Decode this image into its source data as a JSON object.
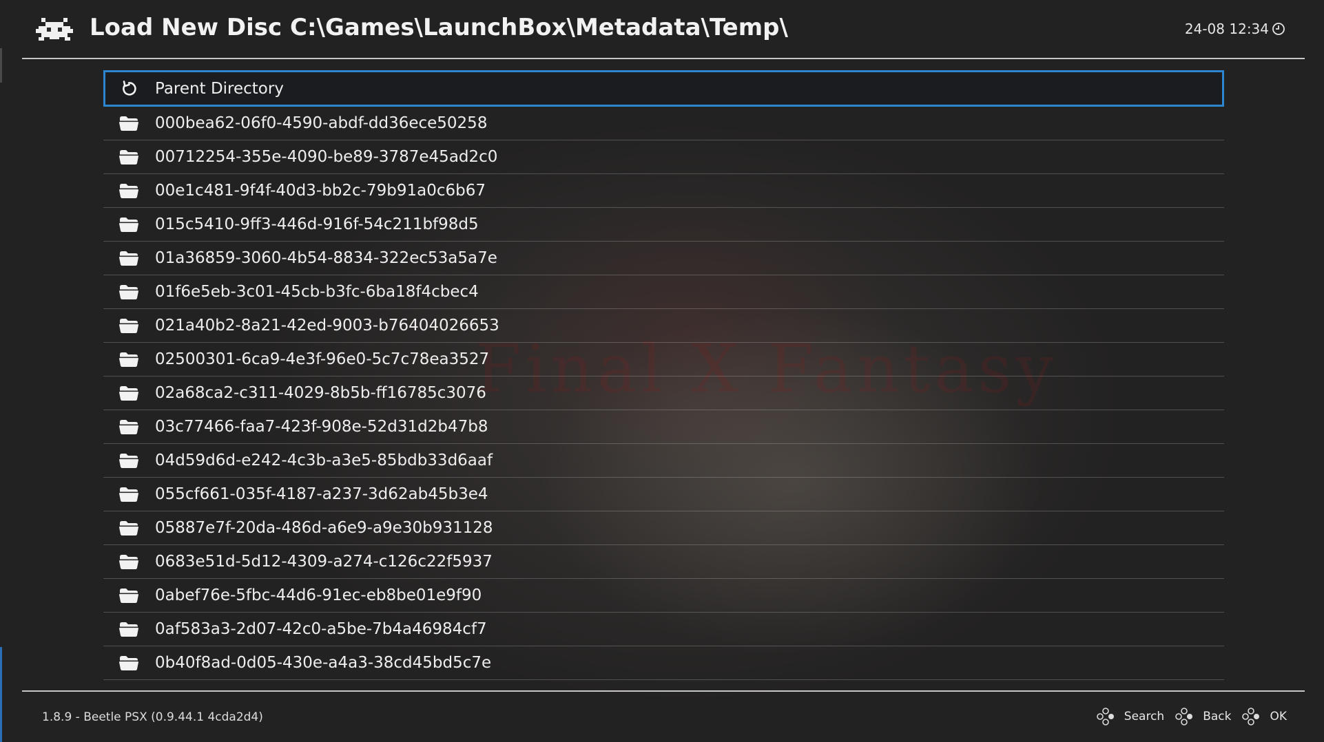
{
  "header": {
    "title": "Load New Disc C:\\Games\\LaunchBox\\Metadata\\Temp\\",
    "clock": "24-08 12:34",
    "logo_icon": "retroarch-invader-icon",
    "clock_icon": "clock-icon"
  },
  "list": {
    "items": [
      {
        "label": "Parent Directory",
        "icon": "refresh-icon",
        "selected": true
      },
      {
        "label": "000bea62-06f0-4590-abdf-dd36ece50258",
        "icon": "folder-icon"
      },
      {
        "label": "00712254-355e-4090-be89-3787e45ad2c0",
        "icon": "folder-icon"
      },
      {
        "label": "00e1c481-9f4f-40d3-bb2c-79b91a0c6b67",
        "icon": "folder-icon"
      },
      {
        "label": "015c5410-9ff3-446d-916f-54c211bf98d5",
        "icon": "folder-icon"
      },
      {
        "label": "01a36859-3060-4b54-8834-322ec53a5a7e",
        "icon": "folder-icon"
      },
      {
        "label": "01f6e5eb-3c01-45cb-b3fc-6ba18f4cbec4",
        "icon": "folder-icon"
      },
      {
        "label": "021a40b2-8a21-42ed-9003-b76404026653",
        "icon": "folder-icon"
      },
      {
        "label": "02500301-6ca9-4e3f-96e0-5c7c78ea3527",
        "icon": "folder-icon"
      },
      {
        "label": "02a68ca2-c311-4029-8b5b-ff16785c3076",
        "icon": "folder-icon"
      },
      {
        "label": "03c77466-faa7-423f-908e-52d31d2b47b8",
        "icon": "folder-icon"
      },
      {
        "label": "04d59d6d-e242-4c3b-a3e5-85bdb33d6aaf",
        "icon": "folder-icon"
      },
      {
        "label": "055cf661-035f-4187-a237-3d62ab45b3e4",
        "icon": "folder-icon"
      },
      {
        "label": "05887e7f-20da-486d-a6e9-a9e30b931128",
        "icon": "folder-icon"
      },
      {
        "label": "0683e51d-5d12-4309-a274-c126c22f5937",
        "icon": "folder-icon"
      },
      {
        "label": "0abef76e-5fbc-44d6-91ec-eb8be01e9f90",
        "icon": "folder-icon"
      },
      {
        "label": "0af583a3-2d07-42c0-a5be-7b4a46984cf7",
        "icon": "folder-icon"
      },
      {
        "label": "0b40f8ad-0d05-430e-a4a3-38cd45bd5c7e",
        "icon": "folder-icon"
      }
    ]
  },
  "footer": {
    "version": "1.8.9 - Beetle PSX (0.9.44.1 4cda2d4)",
    "buttons": [
      {
        "label": "Search",
        "icon": "gamepad-buttons-icon"
      },
      {
        "label": "Back",
        "icon": "gamepad-buttons-icon"
      },
      {
        "label": "OK",
        "icon": "gamepad-buttons-icon"
      }
    ]
  },
  "colors": {
    "accent": "#2e86d1",
    "text": "#eeeeee",
    "divider": "#c8c8c8"
  }
}
